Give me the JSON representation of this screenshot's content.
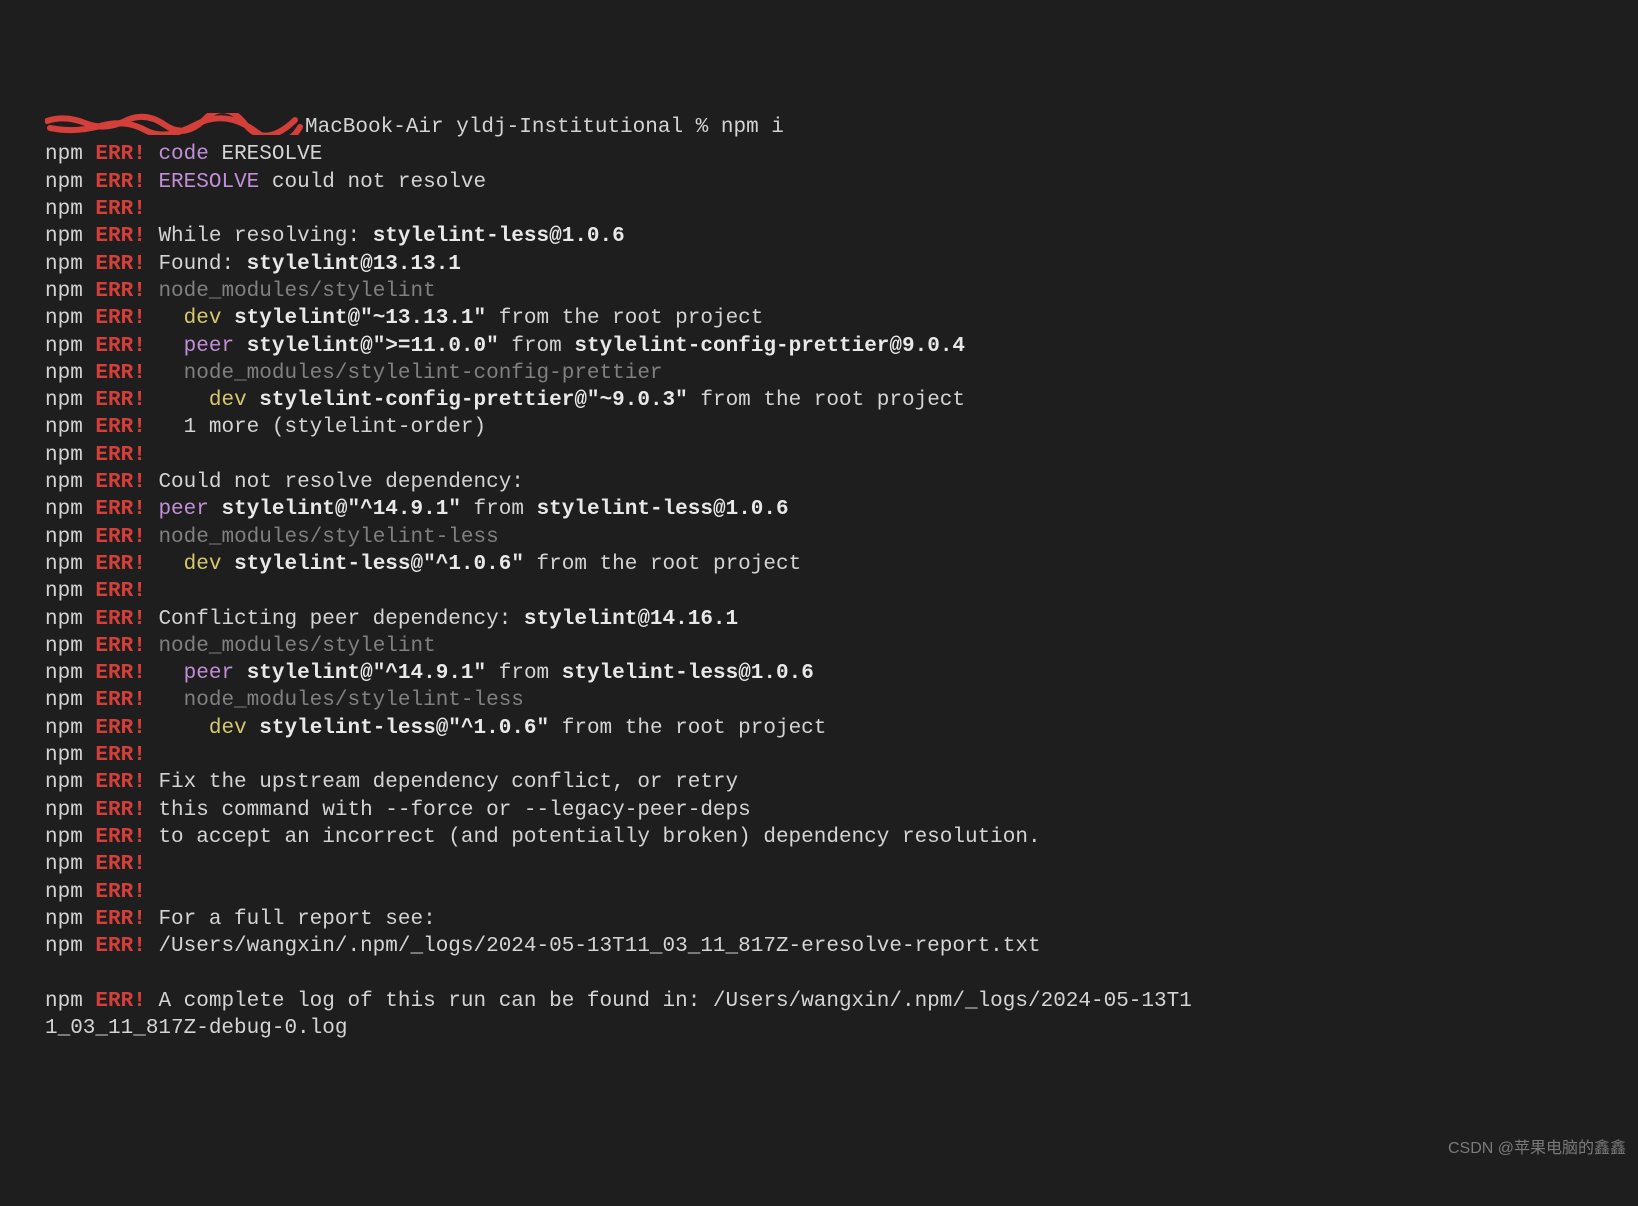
{
  "prompt": {
    "host_suffix": "MacBook-Air yldj-Institutional % npm i"
  },
  "lines": [
    {
      "segments": [
        {
          "t": "npm",
          "c": "npm"
        },
        {
          "t": " "
        },
        {
          "t": "ERR!",
          "c": "err"
        },
        {
          "t": " "
        },
        {
          "t": "code",
          "c": "code"
        },
        {
          "t": " ERESOLVE",
          "c": "txt"
        }
      ]
    },
    {
      "segments": [
        {
          "t": "npm",
          "c": "npm"
        },
        {
          "t": " "
        },
        {
          "t": "ERR!",
          "c": "err"
        },
        {
          "t": " "
        },
        {
          "t": "ERESOLVE",
          "c": "code"
        },
        {
          "t": " could not resolve",
          "c": "txt"
        }
      ]
    },
    {
      "segments": [
        {
          "t": "npm",
          "c": "npm"
        },
        {
          "t": " "
        },
        {
          "t": "ERR!",
          "c": "err"
        }
      ]
    },
    {
      "segments": [
        {
          "t": "npm",
          "c": "npm"
        },
        {
          "t": " "
        },
        {
          "t": "ERR!",
          "c": "err"
        },
        {
          "t": " While resolving: ",
          "c": "txt"
        },
        {
          "t": "stylelint-less@1.0.6",
          "c": "bold"
        }
      ]
    },
    {
      "segments": [
        {
          "t": "npm",
          "c": "npm"
        },
        {
          "t": " "
        },
        {
          "t": "ERR!",
          "c": "err"
        },
        {
          "t": " Found: ",
          "c": "txt"
        },
        {
          "t": "stylelint@13.13.1",
          "c": "bold"
        }
      ]
    },
    {
      "segments": [
        {
          "t": "npm",
          "c": "npm"
        },
        {
          "t": " "
        },
        {
          "t": "ERR!",
          "c": "err"
        },
        {
          "t": " "
        },
        {
          "t": "node_modules/stylelint",
          "c": "dim"
        }
      ]
    },
    {
      "segments": [
        {
          "t": "npm",
          "c": "npm"
        },
        {
          "t": " "
        },
        {
          "t": "ERR!",
          "c": "err"
        },
        {
          "t": "   "
        },
        {
          "t": "dev",
          "c": "dev"
        },
        {
          "t": " "
        },
        {
          "t": "stylelint@\"~13.13.1\"",
          "c": "bold"
        },
        {
          "t": " from the root project",
          "c": "txt"
        }
      ]
    },
    {
      "segments": [
        {
          "t": "npm",
          "c": "npm"
        },
        {
          "t": " "
        },
        {
          "t": "ERR!",
          "c": "err"
        },
        {
          "t": "   "
        },
        {
          "t": "peer",
          "c": "peer"
        },
        {
          "t": " "
        },
        {
          "t": "stylelint@\">=11.0.0\"",
          "c": "bold"
        },
        {
          "t": " from ",
          "c": "txt"
        },
        {
          "t": "stylelint-config-prettier@9.0.4",
          "c": "bold"
        }
      ]
    },
    {
      "segments": [
        {
          "t": "npm",
          "c": "npm"
        },
        {
          "t": " "
        },
        {
          "t": "ERR!",
          "c": "err"
        },
        {
          "t": "   "
        },
        {
          "t": "node_modules/stylelint-config-prettier",
          "c": "dim"
        }
      ]
    },
    {
      "segments": [
        {
          "t": "npm",
          "c": "npm"
        },
        {
          "t": " "
        },
        {
          "t": "ERR!",
          "c": "err"
        },
        {
          "t": "     "
        },
        {
          "t": "dev",
          "c": "dev"
        },
        {
          "t": " "
        },
        {
          "t": "stylelint-config-prettier@\"~9.0.3\"",
          "c": "bold"
        },
        {
          "t": " from the root project",
          "c": "txt"
        }
      ]
    },
    {
      "segments": [
        {
          "t": "npm",
          "c": "npm"
        },
        {
          "t": " "
        },
        {
          "t": "ERR!",
          "c": "err"
        },
        {
          "t": "   1 more (stylelint-order)",
          "c": "txt"
        }
      ]
    },
    {
      "segments": [
        {
          "t": "npm",
          "c": "npm"
        },
        {
          "t": " "
        },
        {
          "t": "ERR!",
          "c": "err"
        }
      ]
    },
    {
      "segments": [
        {
          "t": "npm",
          "c": "npm"
        },
        {
          "t": " "
        },
        {
          "t": "ERR!",
          "c": "err"
        },
        {
          "t": " Could not resolve dependency:",
          "c": "txt"
        }
      ]
    },
    {
      "segments": [
        {
          "t": "npm",
          "c": "npm"
        },
        {
          "t": " "
        },
        {
          "t": "ERR!",
          "c": "err"
        },
        {
          "t": " "
        },
        {
          "t": "peer",
          "c": "peer"
        },
        {
          "t": " "
        },
        {
          "t": "stylelint@\"^14.9.1\"",
          "c": "bold"
        },
        {
          "t": " from ",
          "c": "txt"
        },
        {
          "t": "stylelint-less@1.0.6",
          "c": "bold"
        }
      ]
    },
    {
      "segments": [
        {
          "t": "npm",
          "c": "npm"
        },
        {
          "t": " "
        },
        {
          "t": "ERR!",
          "c": "err"
        },
        {
          "t": " "
        },
        {
          "t": "node_modules/stylelint-less",
          "c": "dim"
        }
      ]
    },
    {
      "segments": [
        {
          "t": "npm",
          "c": "npm"
        },
        {
          "t": " "
        },
        {
          "t": "ERR!",
          "c": "err"
        },
        {
          "t": "   "
        },
        {
          "t": "dev",
          "c": "dev"
        },
        {
          "t": " "
        },
        {
          "t": "stylelint-less@\"^1.0.6\"",
          "c": "bold"
        },
        {
          "t": " from the root project",
          "c": "txt"
        }
      ]
    },
    {
      "segments": [
        {
          "t": "npm",
          "c": "npm"
        },
        {
          "t": " "
        },
        {
          "t": "ERR!",
          "c": "err"
        }
      ]
    },
    {
      "segments": [
        {
          "t": "npm",
          "c": "npm"
        },
        {
          "t": " "
        },
        {
          "t": "ERR!",
          "c": "err"
        },
        {
          "t": " Conflicting peer dependency: ",
          "c": "txt"
        },
        {
          "t": "stylelint@14.16.1",
          "c": "bold"
        }
      ]
    },
    {
      "segments": [
        {
          "t": "npm",
          "c": "npm"
        },
        {
          "t": " "
        },
        {
          "t": "ERR!",
          "c": "err"
        },
        {
          "t": " "
        },
        {
          "t": "node_modules/stylelint",
          "c": "dim"
        }
      ]
    },
    {
      "segments": [
        {
          "t": "npm",
          "c": "npm"
        },
        {
          "t": " "
        },
        {
          "t": "ERR!",
          "c": "err"
        },
        {
          "t": "   "
        },
        {
          "t": "peer",
          "c": "peer"
        },
        {
          "t": " "
        },
        {
          "t": "stylelint@\"^14.9.1\"",
          "c": "bold"
        },
        {
          "t": " from ",
          "c": "txt"
        },
        {
          "t": "stylelint-less@1.0.6",
          "c": "bold"
        }
      ]
    },
    {
      "segments": [
        {
          "t": "npm",
          "c": "npm"
        },
        {
          "t": " "
        },
        {
          "t": "ERR!",
          "c": "err"
        },
        {
          "t": "   "
        },
        {
          "t": "node_modules/stylelint-less",
          "c": "dim"
        }
      ]
    },
    {
      "segments": [
        {
          "t": "npm",
          "c": "npm"
        },
        {
          "t": " "
        },
        {
          "t": "ERR!",
          "c": "err"
        },
        {
          "t": "     "
        },
        {
          "t": "dev",
          "c": "dev"
        },
        {
          "t": " "
        },
        {
          "t": "stylelint-less@\"^1.0.6\"",
          "c": "bold"
        },
        {
          "t": " from the root project",
          "c": "txt"
        }
      ]
    },
    {
      "segments": [
        {
          "t": "npm",
          "c": "npm"
        },
        {
          "t": " "
        },
        {
          "t": "ERR!",
          "c": "err"
        }
      ]
    },
    {
      "segments": [
        {
          "t": "npm",
          "c": "npm"
        },
        {
          "t": " "
        },
        {
          "t": "ERR!",
          "c": "err"
        },
        {
          "t": " Fix the upstream dependency conflict, or retry",
          "c": "txt"
        }
      ]
    },
    {
      "segments": [
        {
          "t": "npm",
          "c": "npm"
        },
        {
          "t": " "
        },
        {
          "t": "ERR!",
          "c": "err"
        },
        {
          "t": " this command with --force or --legacy-peer-deps",
          "c": "txt"
        }
      ]
    },
    {
      "segments": [
        {
          "t": "npm",
          "c": "npm"
        },
        {
          "t": " "
        },
        {
          "t": "ERR!",
          "c": "err"
        },
        {
          "t": " to accept an incorrect (and potentially broken) dependency resolution.",
          "c": "txt"
        }
      ]
    },
    {
      "segments": [
        {
          "t": "npm",
          "c": "npm"
        },
        {
          "t": " "
        },
        {
          "t": "ERR!",
          "c": "err"
        }
      ]
    },
    {
      "segments": [
        {
          "t": "npm",
          "c": "npm"
        },
        {
          "t": " "
        },
        {
          "t": "ERR!",
          "c": "err"
        }
      ]
    },
    {
      "segments": [
        {
          "t": "npm",
          "c": "npm"
        },
        {
          "t": " "
        },
        {
          "t": "ERR!",
          "c": "err"
        },
        {
          "t": " For a full report see:",
          "c": "txt"
        }
      ]
    },
    {
      "segments": [
        {
          "t": "npm",
          "c": "npm"
        },
        {
          "t": " "
        },
        {
          "t": "ERR!",
          "c": "err"
        },
        {
          "t": " /Users/wangxin/.npm/_logs/2024-05-13T11_03_11_817Z-eresolve-report.txt",
          "c": "txt"
        }
      ]
    },
    {
      "segments": [
        {
          "t": " "
        }
      ]
    },
    {
      "segments": [
        {
          "t": "npm",
          "c": "npm"
        },
        {
          "t": " "
        },
        {
          "t": "ERR!",
          "c": "err"
        },
        {
          "t": " A complete log of this run can be found in: /Users/wangxin/.npm/_logs/2024-05-13T1",
          "c": "txt"
        }
      ]
    },
    {
      "segments": [
        {
          "t": "1_03_11_817Z-debug-0.log",
          "c": "txt"
        }
      ]
    }
  ],
  "watermark": "CSDN @苹果电脑的鑫鑫"
}
